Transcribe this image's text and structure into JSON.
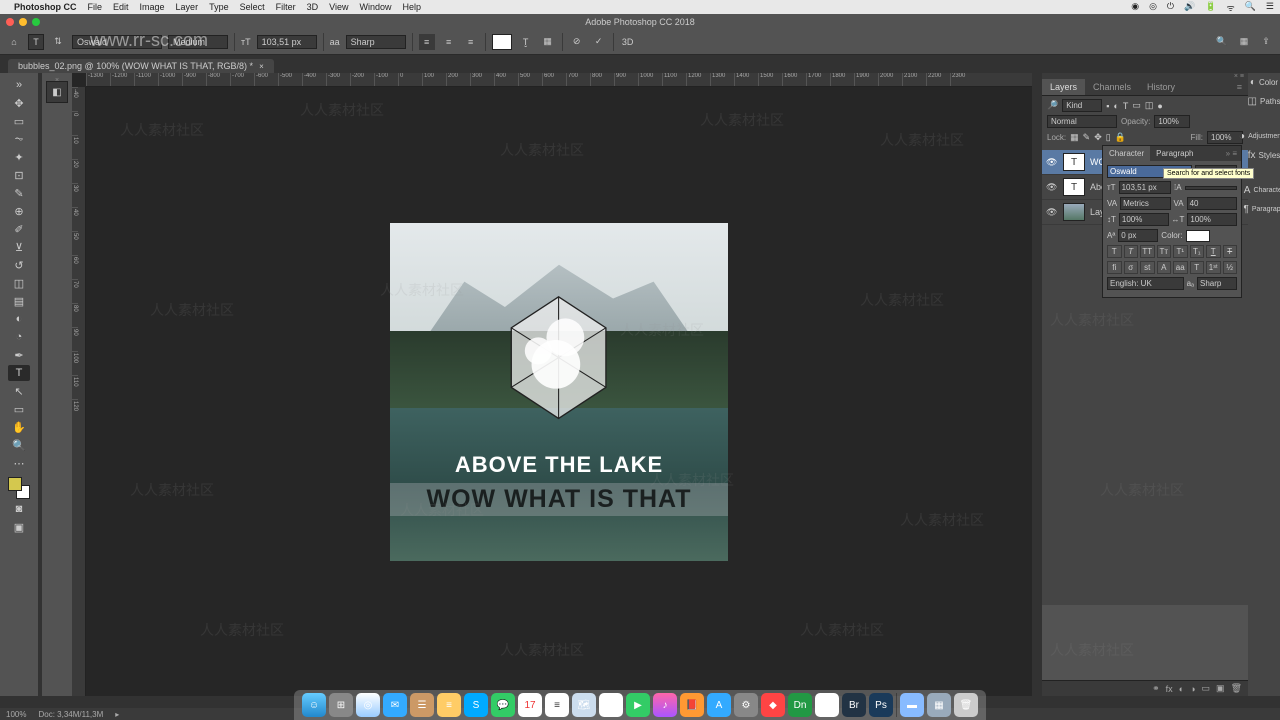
{
  "mac_menu": {
    "app": "Photoshop CC",
    "items": [
      "File",
      "Edit",
      "Image",
      "Layer",
      "Type",
      "Select",
      "Filter",
      "3D",
      "View",
      "Window",
      "Help"
    ],
    "right_icons": [
      "◉",
      "◎",
      "⏻",
      "🔊",
      "🔋",
      "ᯤ",
      "☰"
    ]
  },
  "app_title": "Adobe Photoshop CC 2018",
  "options_bar": {
    "font_family": "Oswald",
    "font_style": "Medium",
    "font_size": "103,51 px",
    "aa_label": "aa",
    "aa_mode": "Sharp",
    "color": "#ffffff"
  },
  "document_tab": "bubbles_02.png @ 100% (WOW WHAT IS THAT, RGB/8) *",
  "ruler_h": [
    "-1300",
    "-1200",
    "-1100",
    "-1000",
    "-900",
    "-800",
    "-700",
    "-600",
    "-500",
    "-400",
    "-300",
    "-200",
    "-100",
    "0",
    "100",
    "200",
    "300",
    "400",
    "500",
    "600",
    "700",
    "800",
    "900",
    "1000",
    "1100",
    "1200",
    "1300",
    "1400",
    "1500",
    "1600",
    "1700",
    "1800",
    "1900",
    "2000",
    "2100",
    "2200",
    "2300"
  ],
  "ruler_v": [
    "-40",
    "0",
    "10",
    "20",
    "30",
    "40",
    "50",
    "60",
    "70",
    "80",
    "90",
    "100",
    "110",
    "120"
  ],
  "canvas": {
    "text1": "ABOVE THE LAKE",
    "text2": "WOW WHAT IS THAT"
  },
  "layers_panel": {
    "tabs": [
      "Layers",
      "Channels",
      "History"
    ],
    "filter": "Kind",
    "blend_mode": "Normal",
    "opacity_label": "Opacity:",
    "opacity": "100%",
    "lock_label": "Lock:",
    "fill_label": "Fill:",
    "fill": "100%",
    "layers": [
      {
        "name": "WOW WHAT",
        "type": "T",
        "selected": true
      },
      {
        "name": "Above the la",
        "type": "T",
        "selected": false
      },
      {
        "name": "Layer 0",
        "type": "img",
        "selected": false
      }
    ]
  },
  "char_panel": {
    "tabs": [
      "Character",
      "Paragraph"
    ],
    "font_family": "Oswald",
    "font_style": "Medium",
    "tooltip": "Search for and select fonts",
    "size": "103,51 px",
    "leading": "",
    "kerning": "Metrics",
    "tracking": "40",
    "vscale": "100%",
    "hscale": "100%",
    "baseline": "0 px",
    "color_label": "Color:",
    "lang": "English: UK",
    "aa": "Sharp"
  },
  "right_strip": {
    "items": [
      {
        "icon": "◐",
        "label": "Color"
      },
      {
        "icon": "◫",
        "label": "Paths"
      },
      {
        "icon": "◑",
        "label": "Adjustment..."
      },
      {
        "icon": "fx",
        "label": "Styles"
      },
      {
        "icon": "A",
        "label": "Character"
      },
      {
        "icon": "¶",
        "label": "Paragraph"
      }
    ]
  },
  "status": {
    "zoom": "100%",
    "doc": "Doc: 3,34M/11,3M"
  },
  "watermark_url": "www.rr-sc.com",
  "watermark_cn": "人人素材社区"
}
